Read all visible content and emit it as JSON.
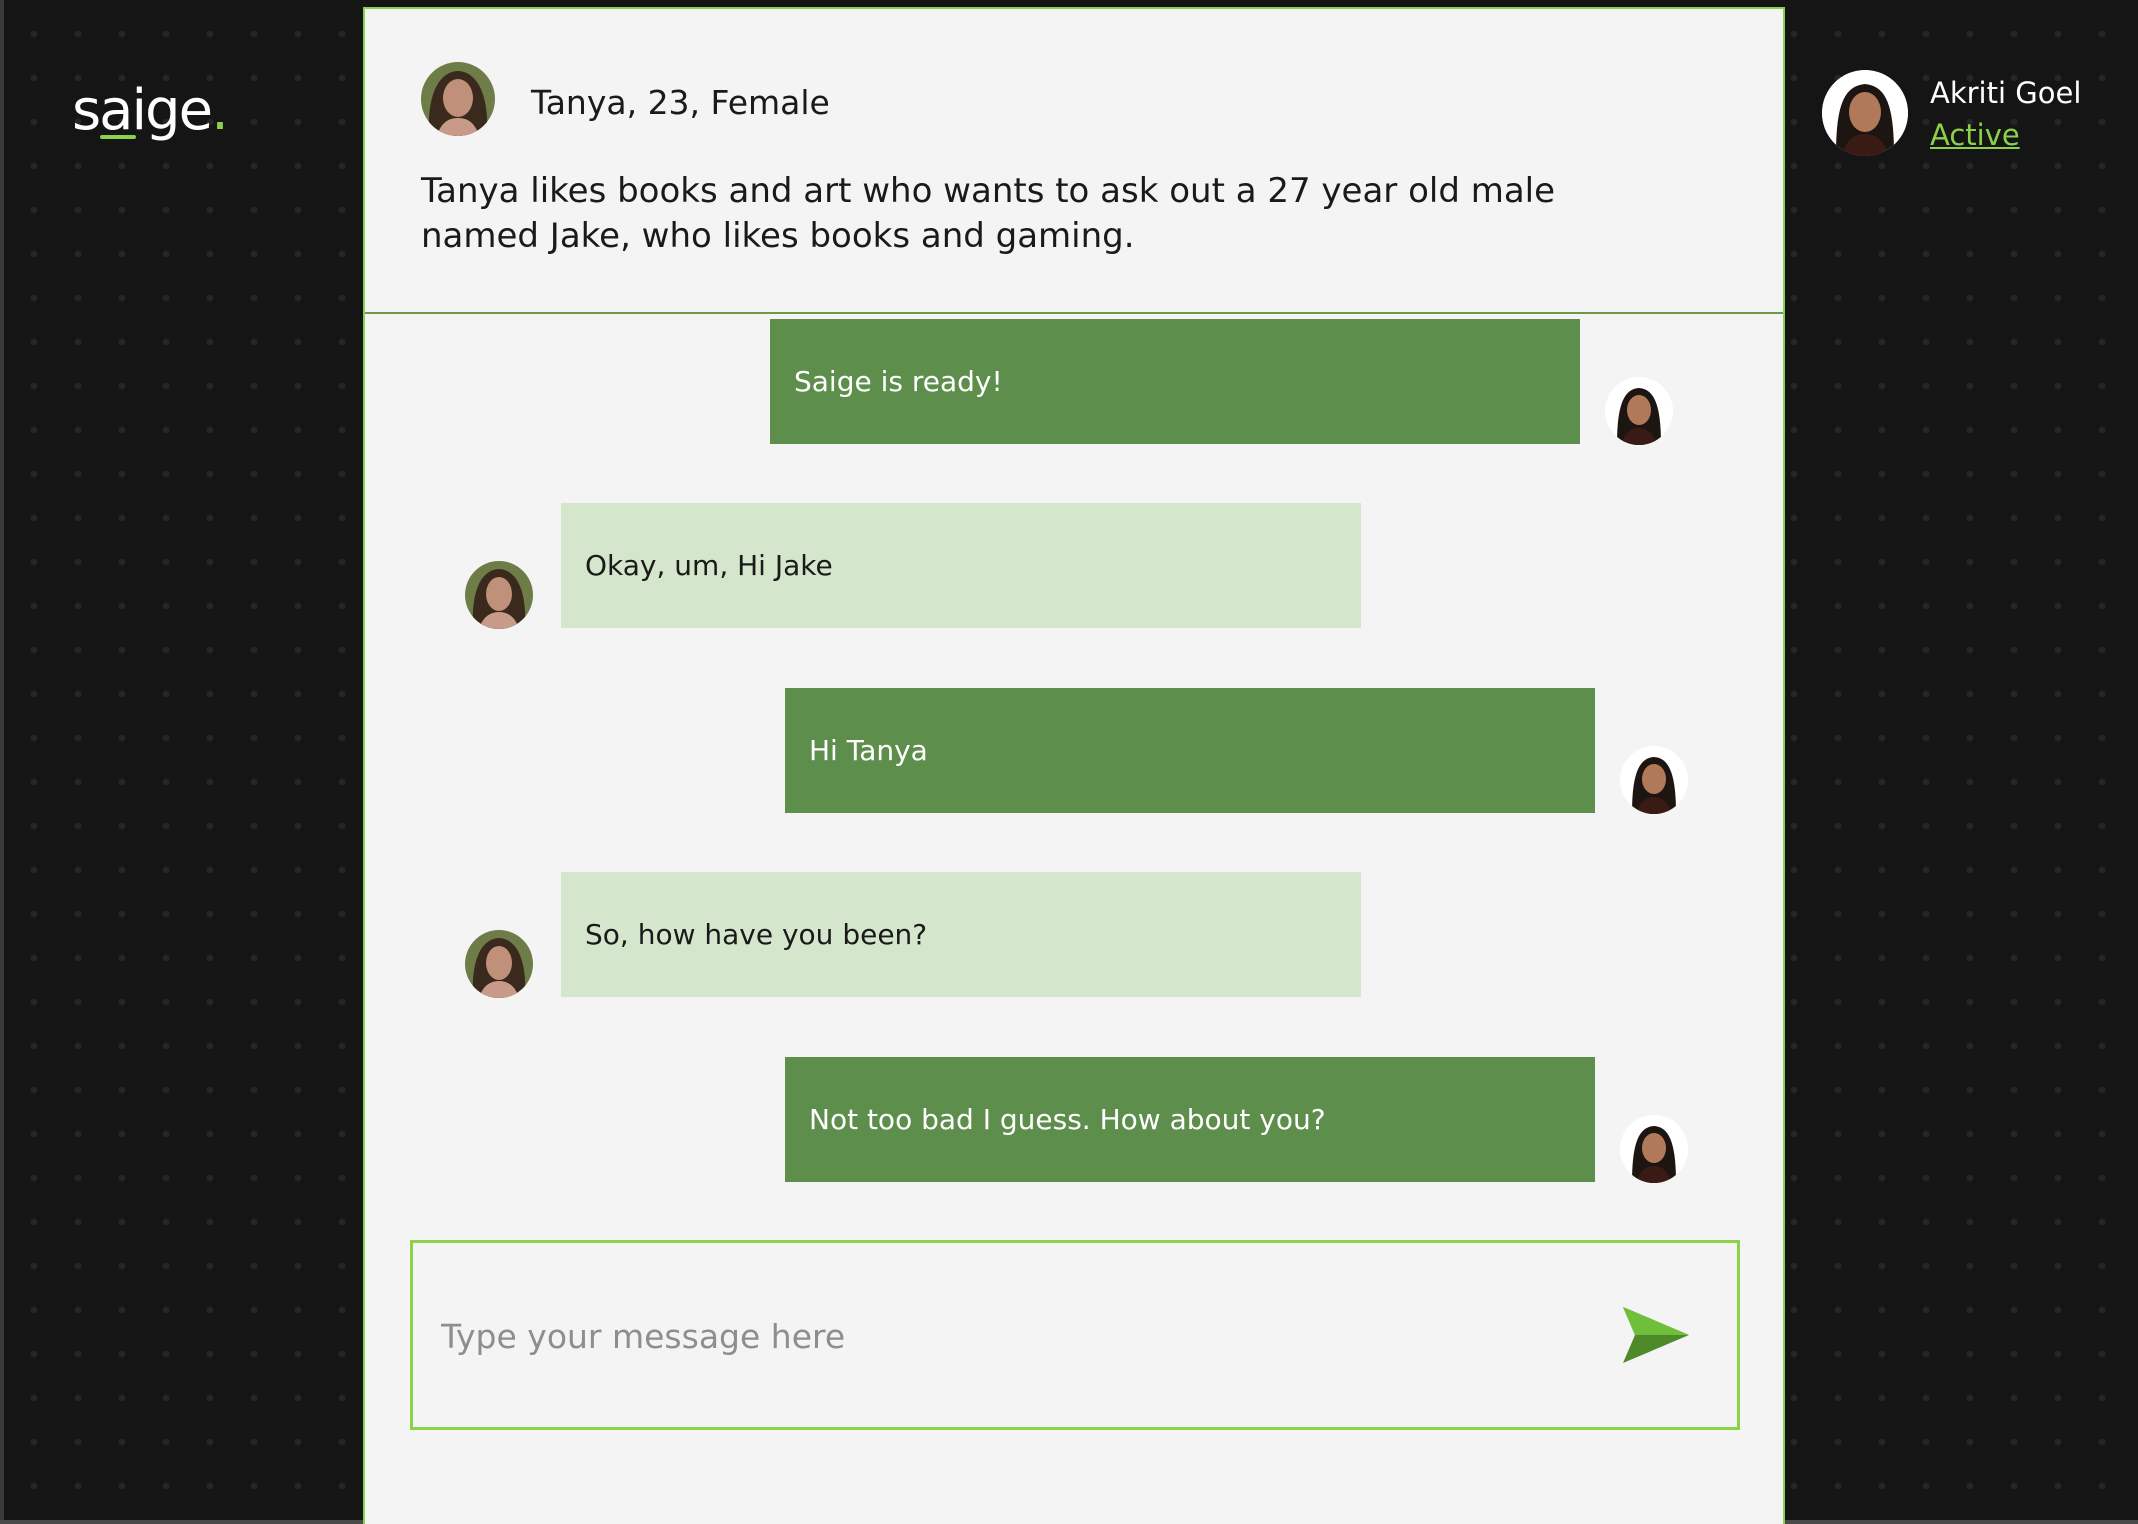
{
  "app": {
    "logo_text": "saige",
    "logo_dot": "."
  },
  "user": {
    "name": "Akriti Goel",
    "status": "Active"
  },
  "persona": {
    "title": "Tanya, 23, Female",
    "description": "Tanya likes books and art who wants to ask out a 27 year old male named Jake, who likes books and gaming."
  },
  "messages": [
    {
      "sender": "bot",
      "text": "Saige is ready!"
    },
    {
      "sender": "user",
      "text": "Okay, um, Hi Jake"
    },
    {
      "sender": "bot",
      "text": "Hi Tanya"
    },
    {
      "sender": "user",
      "text": "So, how have you been?"
    },
    {
      "sender": "bot",
      "text": "Not too bad I guess. How about you?"
    }
  ],
  "composer": {
    "placeholder": "Type your message here",
    "value": ""
  },
  "icons": {
    "send": "send-arrow-icon",
    "avatar": "avatar-photo"
  },
  "colors": {
    "accent": "#8bd14a",
    "bot_bubble": "#5e8e4c",
    "user_bubble": "#d4e7cc",
    "panel_bg": "#f4f4f4",
    "page_bg": "#151515"
  }
}
